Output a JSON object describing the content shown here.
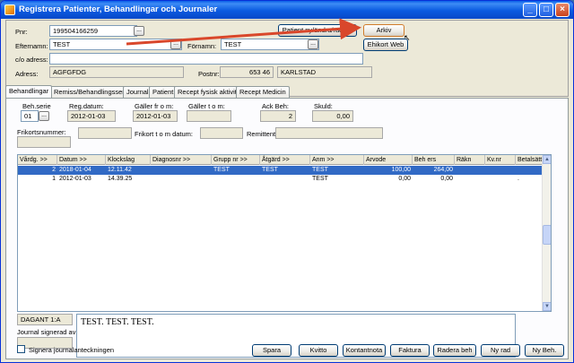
{
  "window": {
    "title": "Registrera Patienter, Behandlingar och Journaler"
  },
  "patient": {
    "pnr_label": "Pnr:",
    "pnr_value": "199504166259",
    "efternamn_label": "Efternamn:",
    "efternamn_value": "TEST",
    "fornamn_label": "Förnamn:",
    "fornamn_value": "TEST",
    "co_label": "c/o adress:",
    "co_value": "",
    "adress_label": "Adress:",
    "adress_value": "AGFGFDG",
    "postnr_label": "Postnr:",
    "postnr_value": "653 46",
    "ort_value": "KARLSTAD",
    "btn_patient": "Patient ny/ändra/radera",
    "btn_arkiv": "Arkiv",
    "btn_ehikort": "Ehikort Web",
    "dots_label": "..."
  },
  "tabs": [
    "Behandlingar",
    "Remiss/Behandlingsserie",
    "Journal",
    "Patient",
    "Recept fysisk aktivitet",
    "Recept Medicin"
  ],
  "serie": {
    "behserie_label": "Beh.serie",
    "behserie_value": "01",
    "regdatum_label": "Reg.datum:",
    "regdatum_value": "2012-01-03",
    "galler_from_label": "Gäller fr o m:",
    "galler_from_value": "2012-01-03",
    "galler_tom_label": "Gäller t o m:",
    "galler_tom_value": "",
    "ackbeh_label": "Ack Beh:",
    "ackbeh_value": "2",
    "skuld_label": "Skuld:",
    "skuld_value": "0,00",
    "frikort_label": "Frikortsnummer:",
    "frikort_value": "",
    "frikort_tom_label": "Frikort t o m datum:",
    "frikort_tom_value": "",
    "remittent_label": "Remittent:",
    "remittent_value": ""
  },
  "grid": {
    "columns": [
      "Vårdg. >>",
      "Datum >>",
      "Klockslag",
      "Diagnosnr >>",
      "Grupp nr >>",
      "Åtgärd >>",
      "Anm >>",
      "Arvode",
      "Beh ers",
      "Räkn",
      "Kv.nr",
      "Betalsätt"
    ],
    "rows": [
      [
        "2",
        "2018-01-04",
        "12.11.42",
        "",
        "TEST",
        "TEST",
        "TEST",
        "100,00",
        "264,00",
        "",
        "",
        ""
      ],
      [
        "1",
        "2012-01-03",
        "14.39.25",
        "",
        "",
        "",
        "TEST",
        "0,00",
        "0,00",
        "",
        "",
        "."
      ]
    ],
    "selected_row": 0
  },
  "bottom": {
    "dagant": "DAGANT 1:A",
    "signerad_label": "Journal signerad av:",
    "signerad_value": "",
    "journal_text": "TEST. TEST. TEST.",
    "checkbox_label": "Signera journalanteckningen",
    "checkbox_checked": false,
    "buttons": [
      "Spara",
      "Kvitto",
      "Kontantnota",
      "Faktura",
      "Radera beh",
      "Ny rad",
      "Ny Beh."
    ]
  },
  "annotation": {
    "arrow_color": "#d9472b"
  }
}
